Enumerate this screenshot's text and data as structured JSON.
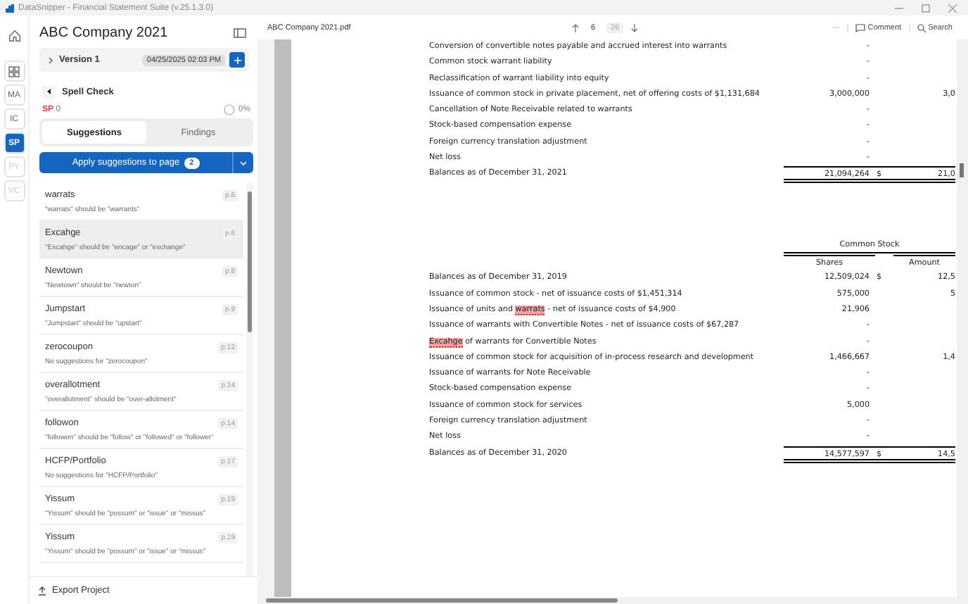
{
  "title_bar": {
    "title": "DataSnipper - Financial Statement Suite (v.25.1.3.0)"
  },
  "rail": [
    {
      "kind": "home",
      "selected": false,
      "disabled": false
    },
    {
      "kind": "grid",
      "selected": false,
      "disabled": false
    },
    {
      "kind": "label",
      "label": "MA",
      "selected": false,
      "disabled": false
    },
    {
      "kind": "label",
      "label": "IC",
      "selected": false,
      "disabled": false
    },
    {
      "kind": "label",
      "label": "SP",
      "selected": true,
      "disabled": false
    },
    {
      "kind": "label",
      "label": "PY",
      "selected": false,
      "disabled": true
    },
    {
      "kind": "label",
      "label": "VC",
      "selected": false,
      "disabled": true
    }
  ],
  "project": {
    "title": "ABC Company 2021",
    "version": {
      "label": "Version 1",
      "expanded": false,
      "date": "04/25/2025 02:03 PM"
    }
  },
  "spell_check": {
    "title": "Spell Check",
    "counter_label": "SP",
    "counter": "0",
    "progress_label": "0%",
    "tabs": [
      {
        "label": "Suggestions",
        "selected": true
      },
      {
        "label": "Findings",
        "selected": false
      }
    ],
    "apply": {
      "label": "Apply suggestions to page",
      "count": "2"
    },
    "items": [
      {
        "word": "warrats",
        "page": "p.6",
        "message": "\"warrats\" should be \"warrants\"",
        "selected": false
      },
      {
        "word": "Excahge",
        "page": "p.6",
        "message": "\"Excahge\" should be \"encage\" or \"exchange\"",
        "selected": true
      },
      {
        "word": "Newtown",
        "page": "p.8",
        "message": "\"Newtown\" should be \"newton\"",
        "selected": false
      },
      {
        "word": "Jumpstart",
        "page": "p.9",
        "message": "\"Jumpstart\" should be \"upstart\"",
        "selected": false
      },
      {
        "word": "zerocoupon",
        "page": "p.12",
        "message": "No suggestions for \"zerocoupon\"",
        "selected": false
      },
      {
        "word": "overallotment",
        "page": "p.14",
        "message": "\"overallotment\" should be \"over-allotment\"",
        "selected": false
      },
      {
        "word": "followon",
        "page": "p.14",
        "message": "\"followon\" should be \"follow\" or \"followed\" or \"follower\"",
        "selected": false
      },
      {
        "word": "HCFP/Portfolio",
        "page": "p.17",
        "message": "No suggestions for \"HCFP/Portfolio\"",
        "selected": false
      },
      {
        "word": "Yissum",
        "page": "p.19",
        "message": "\"Yissum\" should be \"possum\" or \"issue\" or \"missus\"",
        "selected": false
      },
      {
        "word": "Yissum",
        "page": "p.19",
        "message": "\"Yissum\" should be \"possum\" or \"issue\" or \"missus\"",
        "selected": false
      }
    ]
  },
  "footer": {
    "label": "Export Project"
  },
  "document": {
    "file_name": "ABC Company 2021.pdf",
    "page": "6",
    "page_count": "26",
    "more": "···",
    "comment_label": "Comment",
    "search_label": "Search",
    "sections": [
      {
        "rows": [
          {
            "kind": "item",
            "label": "Conversion of convertible notes payable and accrued interest into warrants",
            "shares": "-"
          },
          {
            "kind": "item",
            "label": "Common stock warrant liability",
            "shares": "-"
          },
          {
            "kind": "item",
            "label": "Reclassification of warrant liability into equity",
            "shares": "-"
          },
          {
            "kind": "item",
            "label": "Issuance of common stock in private placement, net of offering costs of $1,131,684",
            "shares": "3,000,000",
            "amount": "3,0"
          },
          {
            "kind": "item",
            "label": "Cancellation of Note Receivable related to warrants",
            "shares": "-"
          },
          {
            "kind": "item",
            "label": "Stock-based compensation expense",
            "shares": "-"
          },
          {
            "kind": "item",
            "label": "Foreign currency translation adjustment",
            "shares": "-"
          },
          {
            "kind": "item",
            "label": "Net loss",
            "shares": "-"
          },
          {
            "kind": "total",
            "label": "Balances as of December 31, 2021",
            "shares": "21,094,264",
            "dollar": "$",
            "amount": "21,0"
          }
        ]
      },
      {
        "header": {
          "group": "Common Stock",
          "columns": [
            "Shares",
            "Amount"
          ]
        },
        "rows": [
          {
            "kind": "item",
            "label": "Balances as of December 31, 2019",
            "shares": "12,509,024",
            "dollar": "$",
            "amount": "12,5"
          },
          {
            "kind": "item",
            "label": "Issuance of common stock - net of issuance costs of $1,451,314",
            "shares": "575,000",
            "amount": "5"
          },
          {
            "kind": "item",
            "parts": [
              {
                "text": "Issuance of units and ",
                "flagged": false
              },
              {
                "text": "warrats",
                "flagged": true
              },
              {
                "text": " - net of issuance costs of $4,900",
                "flagged": false
              }
            ],
            "shares": "21,906"
          },
          {
            "kind": "item",
            "label": "Issuance of warrants with Convertible Notes - net of issuance costs of $67,287",
            "shares": "-"
          },
          {
            "kind": "item",
            "parts": [
              {
                "text": "Excahge",
                "flagged": true
              },
              {
                "text": " of warrants for Convertible Notes",
                "flagged": false
              }
            ],
            "shares": "-"
          },
          {
            "kind": "item",
            "label": "Issuance of common stock for acquisition of in-process research and development",
            "shares": "1,466,667",
            "amount": "1,4"
          },
          {
            "kind": "item",
            "label": "Issuance of warrants for Note Receivable",
            "shares": "-"
          },
          {
            "kind": "item",
            "label": "Stock-based compensation expense",
            "shares": "-"
          },
          {
            "kind": "item",
            "label": "Issuance of common stock for services",
            "shares": "5,000"
          },
          {
            "kind": "item",
            "label": "Foreign currency translation adjustment",
            "shares": "-"
          },
          {
            "kind": "item",
            "label": "Net loss",
            "shares": "-"
          },
          {
            "kind": "total",
            "label": "Balances as of December 31, 2020",
            "shares": "14,577,597",
            "dollar": "$",
            "amount": "14,5"
          }
        ]
      }
    ]
  }
}
